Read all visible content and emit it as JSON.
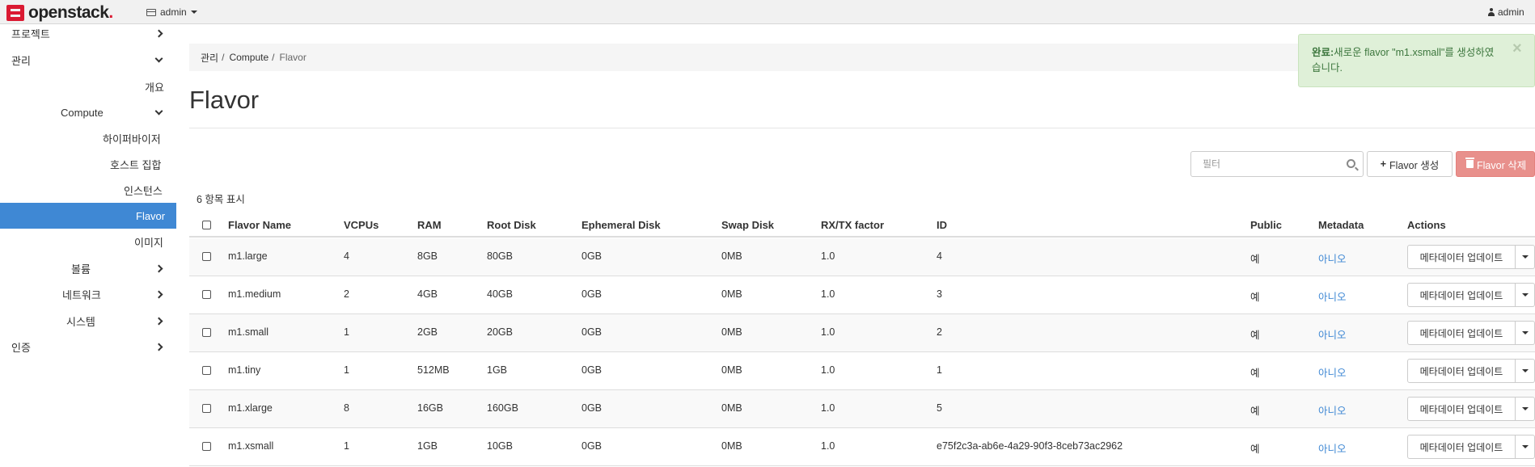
{
  "topbar": {
    "brand": "openstack",
    "project_label": "admin",
    "user_label": "admin"
  },
  "sidebar": {
    "items": [
      {
        "label": "프로젝트",
        "chevron": "right"
      },
      {
        "label": "관리",
        "chevron": "down"
      },
      {
        "label": "개요"
      },
      {
        "label": "Compute",
        "chevron": "down"
      },
      {
        "label": "하이퍼바이저"
      },
      {
        "label": "호스트 집합"
      },
      {
        "label": "인스턴스"
      },
      {
        "label": "Flavor",
        "active": true
      },
      {
        "label": "이미지"
      },
      {
        "label": "볼륨",
        "chevron": "right"
      },
      {
        "label": "네트워크",
        "chevron": "right"
      },
      {
        "label": "시스템",
        "chevron": "right"
      },
      {
        "label": "인증",
        "chevron": "right"
      }
    ]
  },
  "breadcrumb": {
    "items": [
      "관리",
      "Compute",
      "Flavor"
    ],
    "separator": "/"
  },
  "page": {
    "title": "Flavor"
  },
  "alert": {
    "strong": "완료:",
    "message": "새로운 flavor \"m1.xsmall\"를 생성하였습니다.",
    "close": "×",
    "color": "#3c763d",
    "background": "#dff0d8"
  },
  "toolbar": {
    "filter_placeholder": "필터",
    "create_label": "Flavor 생성",
    "delete_label": "Flavor 삭제",
    "delete_color": "#e8908c"
  },
  "table": {
    "count_label": "6 항목 표시",
    "columns": [
      "Flavor Name",
      "VCPUs",
      "RAM",
      "Root Disk",
      "Ephemeral Disk",
      "Swap Disk",
      "RX/TX factor",
      "ID",
      "Public",
      "Metadata",
      "Actions"
    ],
    "rows": [
      {
        "name": "m1.large",
        "vcpus": "4",
        "ram": "8GB",
        "root_disk": "80GB",
        "ephemeral": "0GB",
        "swap": "0MB",
        "rxtx": "1.0",
        "id": "4",
        "public": "예",
        "metadata": "아니오",
        "action": "메타데이터 업데이트"
      },
      {
        "name": "m1.medium",
        "vcpus": "2",
        "ram": "4GB",
        "root_disk": "40GB",
        "ephemeral": "0GB",
        "swap": "0MB",
        "rxtx": "1.0",
        "id": "3",
        "public": "예",
        "metadata": "아니오",
        "action": "메타데이터 업데이트"
      },
      {
        "name": "m1.small",
        "vcpus": "1",
        "ram": "2GB",
        "root_disk": "20GB",
        "ephemeral": "0GB",
        "swap": "0MB",
        "rxtx": "1.0",
        "id": "2",
        "public": "예",
        "metadata": "아니오",
        "action": "메타데이터 업데이트"
      },
      {
        "name": "m1.tiny",
        "vcpus": "1",
        "ram": "512MB",
        "root_disk": "1GB",
        "ephemeral": "0GB",
        "swap": "0MB",
        "rxtx": "1.0",
        "id": "1",
        "public": "예",
        "metadata": "아니오",
        "action": "메타데이터 업데이트"
      },
      {
        "name": "m1.xlarge",
        "vcpus": "8",
        "ram": "16GB",
        "root_disk": "160GB",
        "ephemeral": "0GB",
        "swap": "0MB",
        "rxtx": "1.0",
        "id": "5",
        "public": "예",
        "metadata": "아니오",
        "action": "메타데이터 업데이트"
      },
      {
        "name": "m1.xsmall",
        "vcpus": "1",
        "ram": "1GB",
        "root_disk": "10GB",
        "ephemeral": "0GB",
        "swap": "0MB",
        "rxtx": "1.0",
        "id": "e75f2c3a-ab6e-4a29-90f3-8ceb73ac2962",
        "public": "예",
        "metadata": "아니오",
        "action": "메타데이터 업데이트"
      }
    ]
  },
  "colors": {
    "accent": "#3f88d4",
    "brand_red": "#da1a32"
  }
}
